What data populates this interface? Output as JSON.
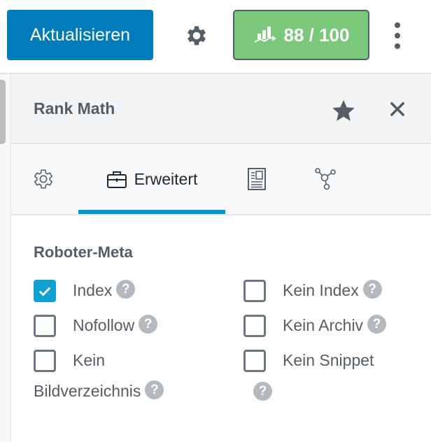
{
  "toolbar": {
    "update_label": "Aktualisieren",
    "settings_icon": "gear-icon",
    "score_icon": "rank-math-chart-icon",
    "score_label": "88 / 100",
    "more_icon": "vertical-ellipsis-icon"
  },
  "panel": {
    "title": "Rank Math",
    "star_icon": "star-icon",
    "close_icon": "close-icon",
    "tabs": [
      {
        "name": "general",
        "label": "",
        "icon": "gear-outline-icon",
        "active": false
      },
      {
        "name": "advanced",
        "label": "Erweitert",
        "icon": "toolbox-icon",
        "active": true
      },
      {
        "name": "schema",
        "label": "",
        "icon": "article-icon",
        "active": false
      },
      {
        "name": "social",
        "label": "",
        "icon": "share-nodes-icon",
        "active": false
      }
    ]
  },
  "robots_meta": {
    "title": "Roboter-Meta",
    "help_glyph": "?",
    "options": [
      {
        "label": "Index",
        "checked": true
      },
      {
        "label": "Nofollow",
        "checked": false
      },
      {
        "label_line1": "Kein",
        "label_line2": "Bildverzeichnis",
        "checked": false
      },
      {
        "label": "Kein Index",
        "checked": false
      },
      {
        "label": "Kein Archiv",
        "checked": false
      },
      {
        "label": "Kein Snippet",
        "checked": false
      }
    ]
  },
  "colors": {
    "primary": "#007cba",
    "score_good": "#7ac97a",
    "tab_active": "#0896cd",
    "checkbox_checked": "#11a0d2"
  }
}
